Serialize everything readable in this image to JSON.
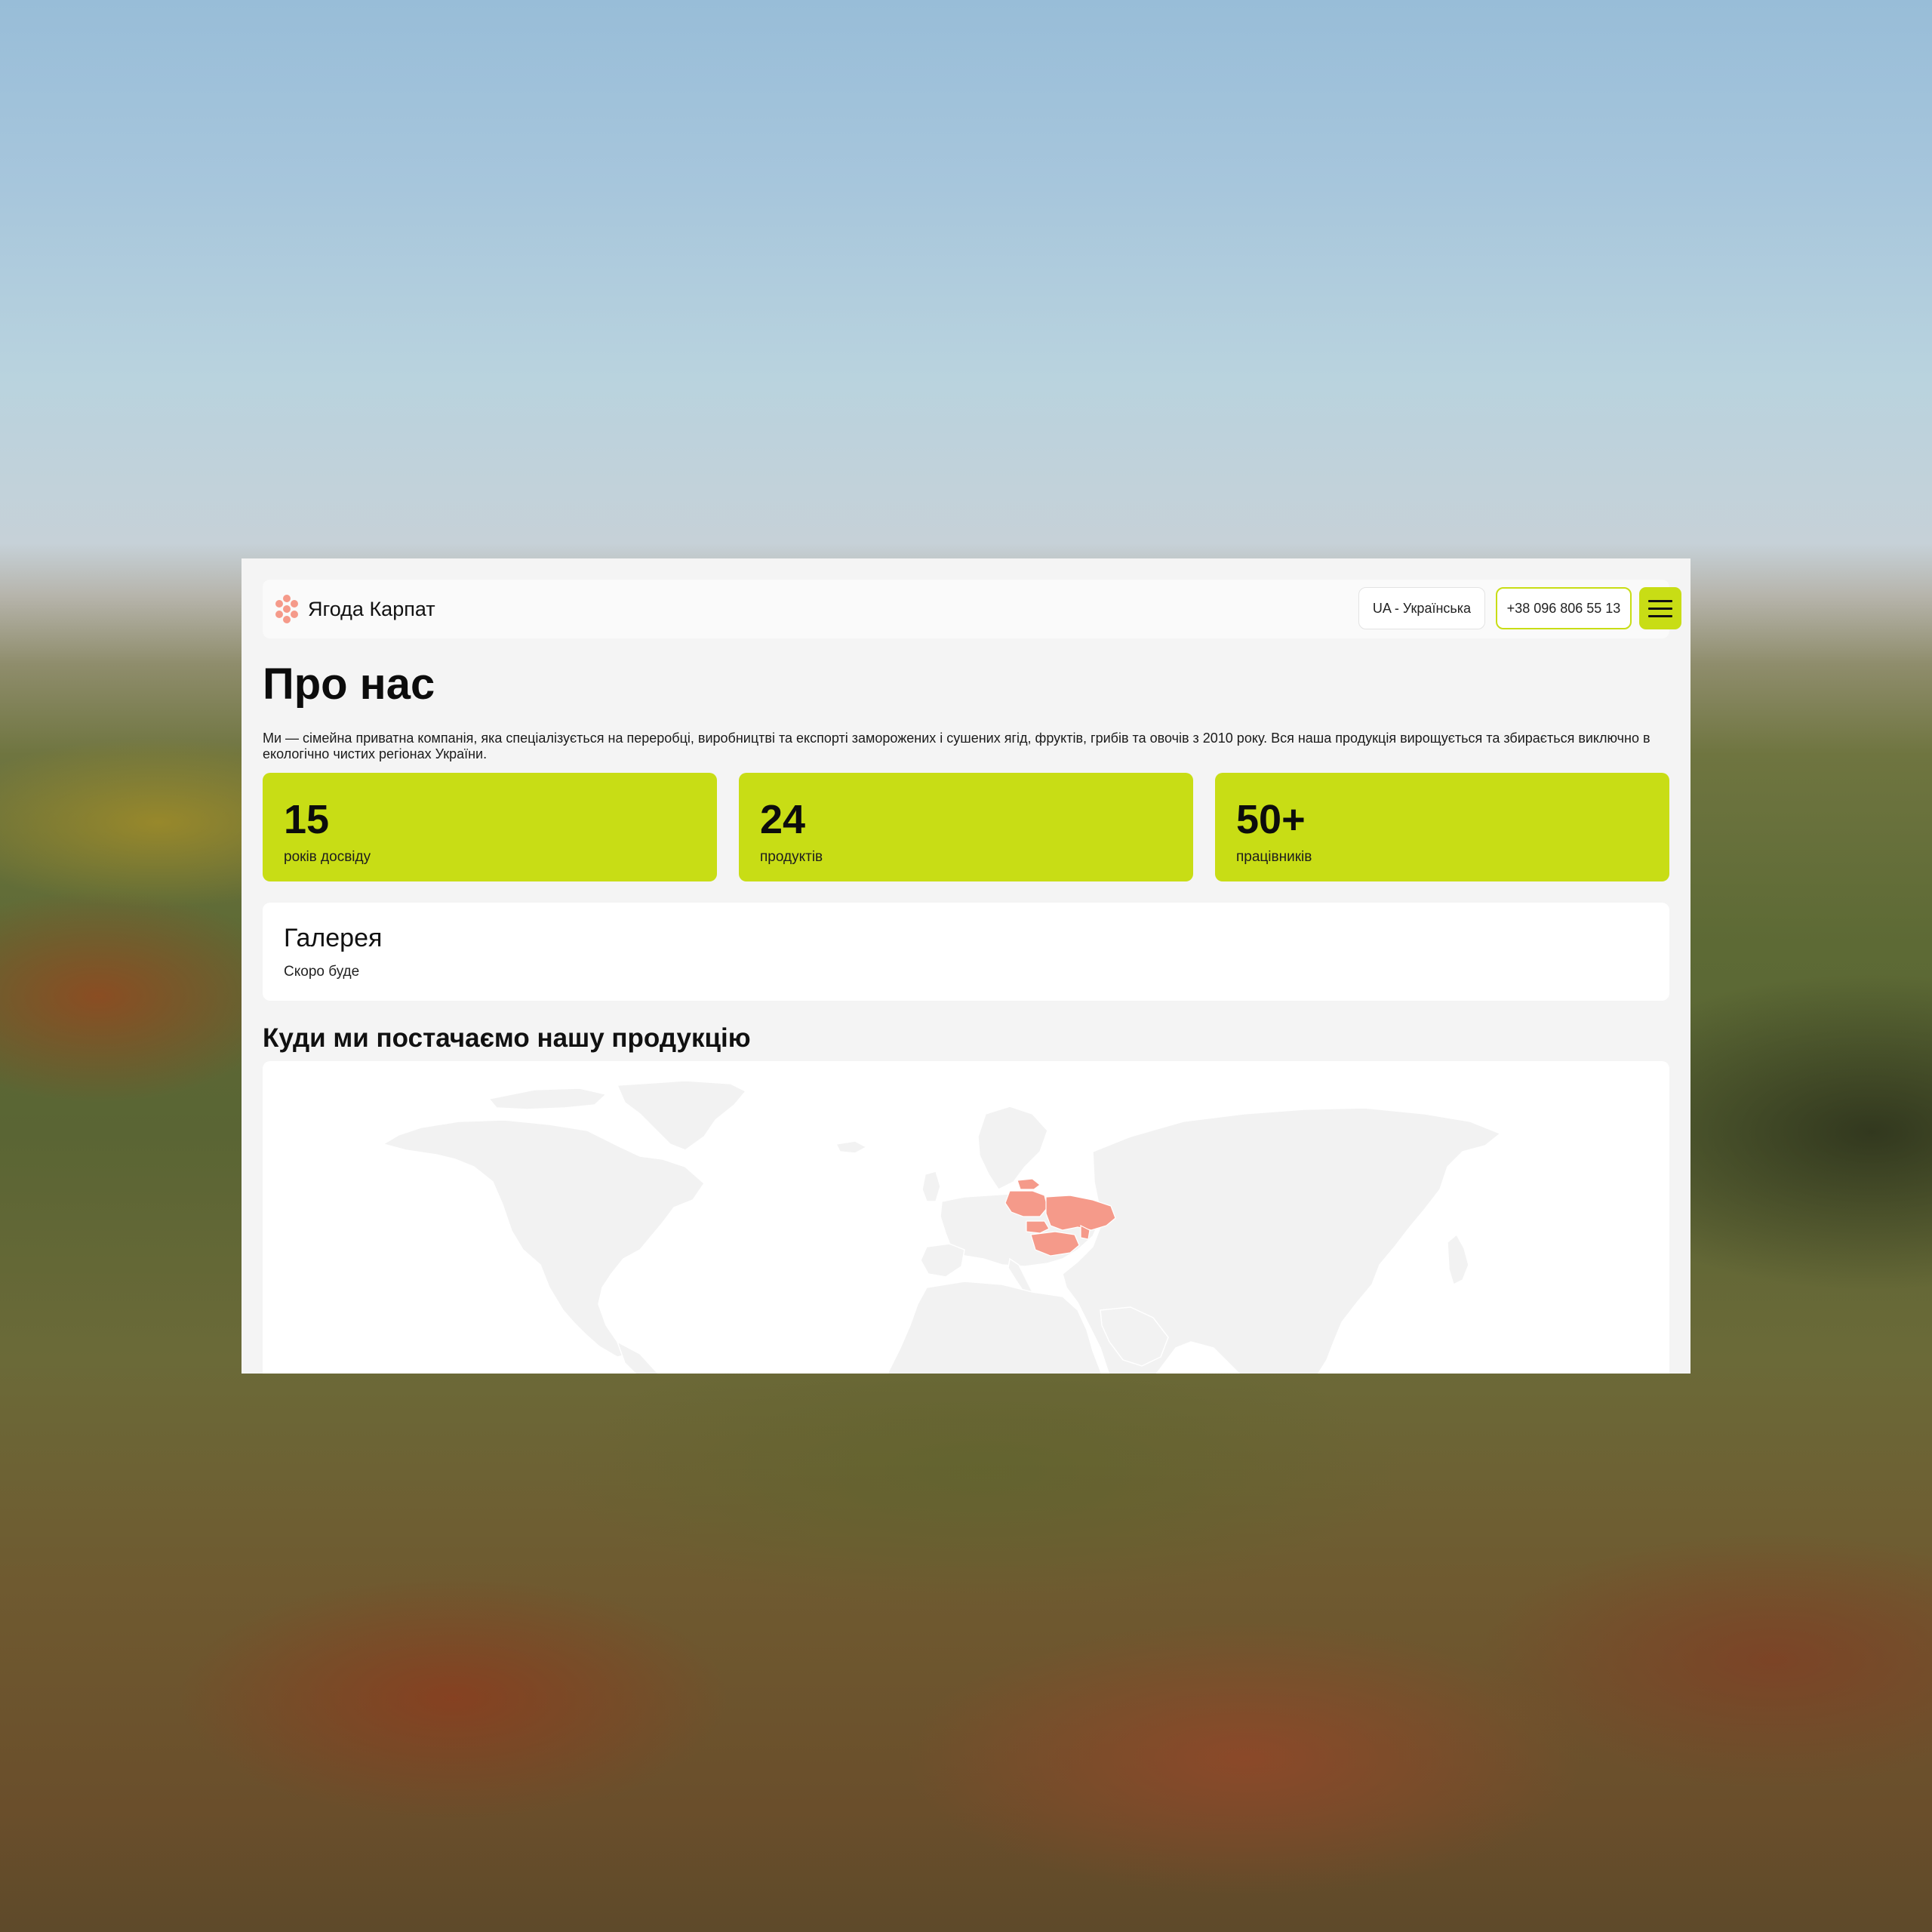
{
  "header": {
    "brand": "Ягода Карпат",
    "language": "UA - Українська",
    "phone": "+38 096 806 55 13"
  },
  "about": {
    "title": "Про нас",
    "intro": "Ми — сімейна приватна компанія, яка спеціалізується на переробці, виробництві та експорті заморожених і сушених ягід, фруктів, грибів та овочів з 2010 року. Вся наша продукція вирощується та збирається виключно в екологічно чистих регіонах України."
  },
  "stats": [
    {
      "value": "15",
      "label": "років досвіду"
    },
    {
      "value": "24",
      "label": "продуктів"
    },
    {
      "value": "50+",
      "label": "працівників"
    }
  ],
  "gallery": {
    "title": "Галерея",
    "subtitle": "Скоро буде"
  },
  "map": {
    "title": "Куди ми постачаємо нашу продукцію",
    "highlight_color": "#f59a8a",
    "land_color": "#f2f2f2"
  },
  "colors": {
    "accent": "#c8dd15",
    "logo": "#f59a8a"
  }
}
